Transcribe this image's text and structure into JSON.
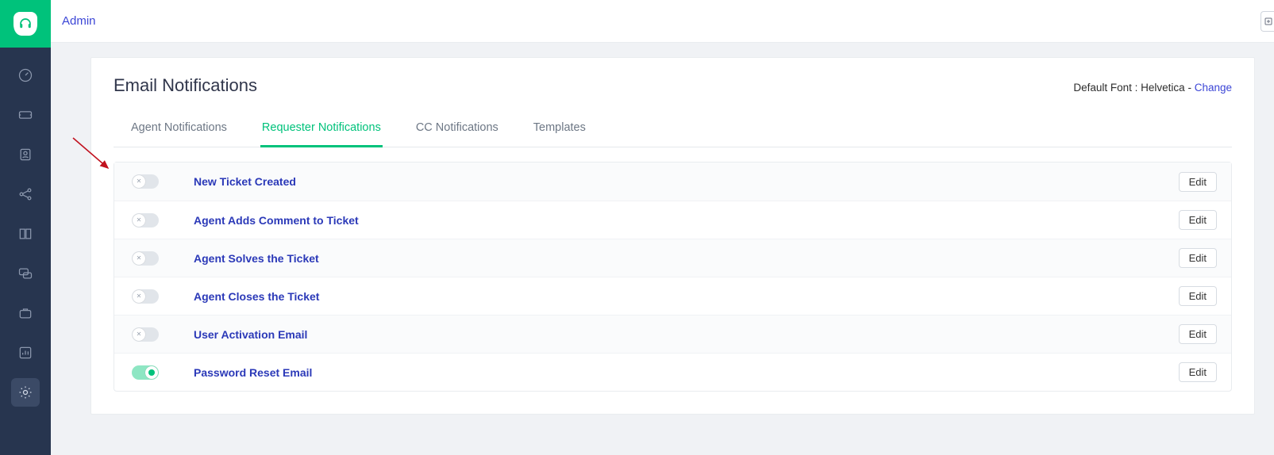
{
  "breadcrumb": {
    "admin": "Admin"
  },
  "page": {
    "title": "Email Notifications",
    "font_label": "Default Font : ",
    "font_name": "Helvetica",
    "dash": " - ",
    "change": "Change"
  },
  "tabs": [
    {
      "label": "Agent Notifications",
      "active": false
    },
    {
      "label": "Requester Notifications",
      "active": true
    },
    {
      "label": "CC Notifications",
      "active": false
    },
    {
      "label": "Templates",
      "active": false
    }
  ],
  "edit_label": "Edit",
  "notifications": [
    {
      "label": "New Ticket Created",
      "on": false
    },
    {
      "label": "Agent Adds Comment to Ticket",
      "on": false
    },
    {
      "label": "Agent Solves the Ticket",
      "on": false
    },
    {
      "label": "Agent Closes the Ticket",
      "on": false
    },
    {
      "label": "User Activation Email",
      "on": false
    },
    {
      "label": "Password Reset Email",
      "on": true
    }
  ],
  "sidebar_icons": [
    "dashboard-icon",
    "tickets-icon",
    "contacts-icon",
    "social-icon",
    "knowledge-icon",
    "chat-icon",
    "assets-icon",
    "reports-icon",
    "settings-icon"
  ]
}
